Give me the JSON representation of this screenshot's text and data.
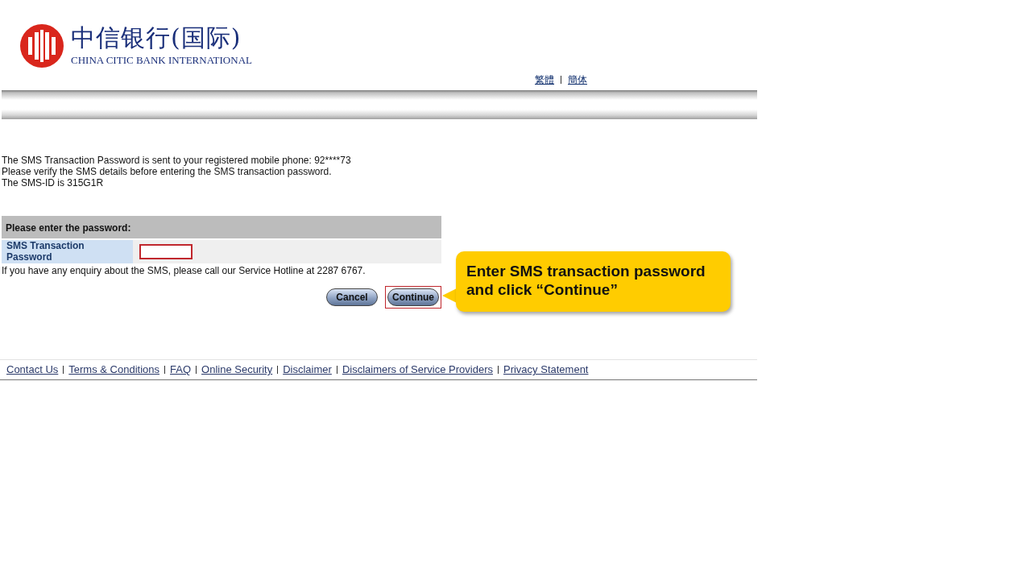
{
  "logo": {
    "chinese": "中信银行(国际)",
    "english": "CHINA CITIC BANK INTERNATIONAL"
  },
  "languages": [
    "繁體",
    "簡体"
  ],
  "info_lines": [
    "The SMS Transaction Password is sent to your registered mobile phone: 92****73",
    "Please verify the SMS details before entering the SMS transaction password.",
    "The SMS-ID is 315G1R"
  ],
  "form": {
    "heading": "Please enter the password:",
    "field_label": "SMS Transaction Password",
    "highlighted": true
  },
  "hotline_note": "If you have any enquiry about the SMS, please call our Service Hotline at 2287 6767.",
  "buttons": [
    {
      "label": "Cancel",
      "highlighted": false
    },
    {
      "label": "Continue",
      "highlighted": true
    }
  ],
  "callout": "Enter SMS transaction password and click “Continue”",
  "footer_links": [
    "Contact Us",
    "Terms & Conditions",
    "FAQ",
    "Online Security",
    "Disclaimer",
    "Disclaimers of Service Providers",
    "Privacy Statement"
  ]
}
